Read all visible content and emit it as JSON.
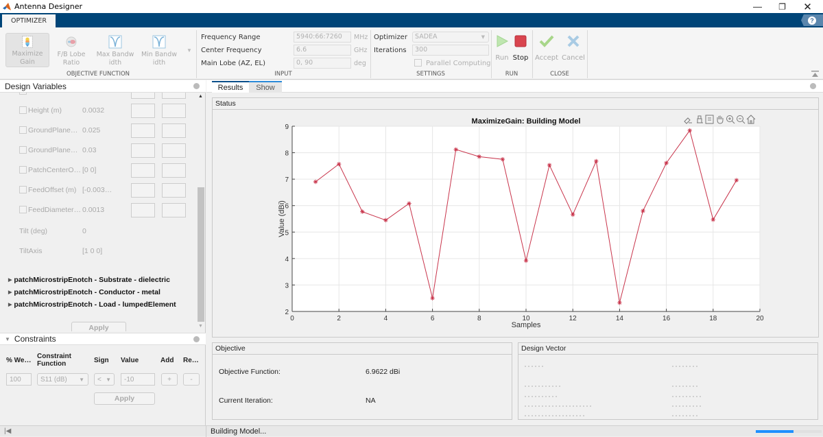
{
  "window": {
    "title": "Antenna Designer",
    "controls": [
      "minimize",
      "restore",
      "close"
    ]
  },
  "ribbon": {
    "tab": "OPTIMIZER",
    "help_icon": "help-icon",
    "objective_function": {
      "section_label": "OBJECTIVE FUNCTION",
      "buttons": [
        {
          "line1": "Maximize",
          "line2": "Gain",
          "icon": "maximize-gain-icon",
          "selected": true
        },
        {
          "line1": "F/B Lobe",
          "line2": "Ratio",
          "icon": "fb-lobe-ratio-icon",
          "selected": false
        },
        {
          "line1": "Max Bandw",
          "line2": "idth",
          "icon": "max-bandwidth-icon",
          "selected": false
        },
        {
          "line1": "Min Bandw",
          "line2": "idth",
          "icon": "min-bandwidth-icon",
          "selected": false
        }
      ]
    },
    "input": {
      "section_label": "INPUT",
      "fields": [
        {
          "label": "Frequency Range",
          "value": "5940:66:7260",
          "unit": "MHz"
        },
        {
          "label": "Center Frequency",
          "value": "6.6",
          "unit": "GHz"
        },
        {
          "label": "Main Lobe (AZ, EL)",
          "value": "0, 90",
          "unit": "deg"
        }
      ]
    },
    "settings": {
      "section_label": "SETTINGS",
      "optimizer_label": "Optimizer",
      "optimizer_value": "SADEA",
      "iterations_label": "Iterations",
      "iterations_value": "300",
      "parallel_label": "Parallel Computing",
      "parallel_checked": false
    },
    "run": {
      "section_label": "RUN",
      "run_label": "Run",
      "stop_label": "Stop"
    },
    "close": {
      "section_label": "CLOSE",
      "accept_label": "Accept",
      "cancel_label": "Cancel"
    }
  },
  "design_variables": {
    "title": "Design Variables",
    "rows": [
      {
        "name": "Height (m)",
        "value": "0.0032",
        "has_checkbox": true,
        "has_bounds": true
      },
      {
        "name": "GroundPlane…",
        "value": "0.025",
        "has_checkbox": true,
        "has_bounds": true
      },
      {
        "name": "GroundPlane…",
        "value": "0.03",
        "has_checkbox": true,
        "has_bounds": true
      },
      {
        "name": "PatchCenterO…",
        "value": "[0 0]",
        "has_checkbox": true,
        "has_bounds": true
      },
      {
        "name": "FeedOffset (m)",
        "value": "[-0.003…",
        "has_checkbox": true,
        "has_bounds": true
      },
      {
        "name": "FeedDiameter…",
        "value": "0.0013",
        "has_checkbox": true,
        "has_bounds": true
      },
      {
        "name": "Tilt (deg)",
        "value": "0",
        "has_checkbox": false,
        "has_bounds": false
      },
      {
        "name": "TiltAxis",
        "value": "[1 0 0]",
        "has_checkbox": false,
        "has_bounds": false
      }
    ],
    "sections": [
      "patchMicrostripEnotch - Substrate - dielectric",
      "patchMicrostripEnotch - Conductor - metal",
      "patchMicrostripEnotch - Load - lumpedElement"
    ],
    "apply_label": "Apply"
  },
  "constraints": {
    "title": "Constraints",
    "headers": [
      "% We…",
      "Constraint Function",
      "Sign",
      "Value",
      "Add",
      "Re…"
    ],
    "row": {
      "weight": "100",
      "function": "S11 (dB)",
      "sign": "<",
      "value": "-10",
      "add": "+",
      "remove": "-"
    },
    "apply_label": "Apply"
  },
  "results": {
    "tabs": [
      {
        "label": "Results",
        "active": true
      },
      {
        "label": "Show",
        "active": false
      }
    ],
    "status_title": "Status",
    "plot_toolbar": [
      "brush-icon",
      "data-tips-icon",
      "legend-icon",
      "pan-icon",
      "zoom-in-icon",
      "zoom-out-icon",
      "home-icon"
    ]
  },
  "chart_data": {
    "type": "line",
    "title": "MaximizeGain: Building Model",
    "xlabel": "Samples",
    "ylabel": "Value (dBi)",
    "xlim": [
      0,
      20
    ],
    "ylim": [
      2,
      9
    ],
    "xticks": [
      0,
      2,
      4,
      6,
      8,
      10,
      12,
      14,
      16,
      18,
      20
    ],
    "yticks": [
      2,
      3,
      4,
      5,
      6,
      7,
      8,
      9
    ],
    "grid": true,
    "marker": "asterisk",
    "color": "#c8334a",
    "x": [
      1,
      2,
      3,
      4,
      5,
      6,
      7,
      8,
      9,
      10,
      11,
      12,
      13,
      14,
      15,
      16,
      17,
      18,
      19
    ],
    "values": [
      6.9,
      7.57,
      5.77,
      5.45,
      6.08,
      2.5,
      8.12,
      7.85,
      7.75,
      3.92,
      7.53,
      5.66,
      7.68,
      2.33,
      5.8,
      7.61,
      8.84,
      5.47,
      6.96
    ]
  },
  "objective": {
    "title": "Objective",
    "function_label": "Objective Function:",
    "function_value": "6.9622 dBi",
    "iteration_label": "Current Iteration:",
    "iteration_value": "NA"
  },
  "design_vector": {
    "title": "Design Vector"
  },
  "status_bar": {
    "message": "Building Model...",
    "progress": 0.57
  }
}
